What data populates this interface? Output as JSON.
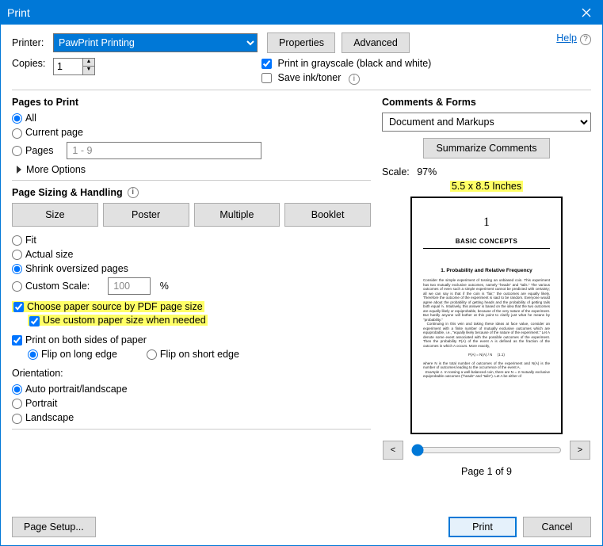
{
  "window": {
    "title": "Print"
  },
  "help": {
    "label": "Help"
  },
  "printer": {
    "label": "Printer:",
    "selected": "PawPrint Printing",
    "properties_btn": "Properties",
    "advanced_btn": "Advanced"
  },
  "copies": {
    "label": "Copies:",
    "value": "1"
  },
  "options": {
    "grayscale": "Print in grayscale (black and white)",
    "saveink": "Save ink/toner"
  },
  "pages_to_print": {
    "title": "Pages to Print",
    "all": "All",
    "current": "Current page",
    "pages": "Pages",
    "pages_value": "1 - 9",
    "more": "More Options"
  },
  "sizing": {
    "title": "Page Sizing & Handling",
    "size_btn": "Size",
    "poster_btn": "Poster",
    "multiple_btn": "Multiple",
    "booklet_btn": "Booklet",
    "fit": "Fit",
    "actual": "Actual size",
    "shrink": "Shrink oversized pages",
    "custom_scale": "Custom Scale:",
    "scale_value": "100",
    "percent": "%",
    "choose_paper": "Choose paper source by PDF page size",
    "use_custom_paper": "Use custom paper size when needed",
    "both_sides": "Print on both sides of paper",
    "flip_long": "Flip on long edge",
    "flip_short": "Flip on short edge"
  },
  "orientation": {
    "title": "Orientation:",
    "auto": "Auto portrait/landscape",
    "portrait": "Portrait",
    "landscape": "Landscape"
  },
  "comments_forms": {
    "title": "Comments & Forms",
    "selected": "Document and Markups",
    "summarize_btn": "Summarize Comments"
  },
  "preview": {
    "scale_label": "Scale:",
    "scale_value": "97%",
    "dims": "5.5 x 8.5 Inches",
    "page_num": "1",
    "page_title": "BASIC CONCEPTS",
    "sub": "1. Probability and Relative Frequency",
    "page_of": "Page 1 of 9",
    "prev": "<",
    "next": ">"
  },
  "footer": {
    "page_setup": "Page Setup...",
    "print": "Print",
    "cancel": "Cancel"
  }
}
